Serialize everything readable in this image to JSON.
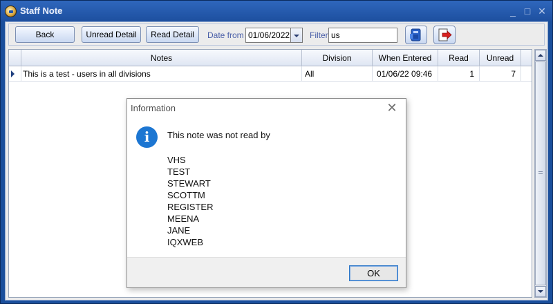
{
  "window": {
    "title": "Staff Note",
    "minimize_glyph": "_",
    "maximize_glyph": "□",
    "close_glyph": "✕"
  },
  "toolbar": {
    "back_label": "Back",
    "unread_detail_label": "Unread Detail",
    "read_detail_label": "Read Detail",
    "date_from_label": "Date from",
    "date_from_value": "01/06/2022",
    "filter_label": "Filter",
    "filter_value": "us",
    "icons": [
      "export-icon",
      "exit-icon"
    ]
  },
  "grid": {
    "columns": [
      "Notes",
      "Division",
      "When Entered",
      "Read",
      "Unread"
    ],
    "rows": [
      {
        "notes": "This is a test - users in all divisions",
        "division": "All",
        "when_entered": "01/06/22 09:46",
        "read": "1",
        "unread": "7"
      }
    ]
  },
  "dialog": {
    "title": "Information",
    "close_glyph": "✕",
    "icon": "info-icon",
    "icon_glyph": "i",
    "message": "This note was not read by",
    "names": [
      "VHS",
      "TEST",
      "STEWART",
      "SCOTTM",
      "REGISTER",
      "MEENA",
      "JANE",
      "IQXWEB"
    ],
    "ok_label": "OK"
  },
  "colors": {
    "window_frame": "#1a4f9c",
    "info_blue": "#1c76d2",
    "label_blue": "#4a5fa8"
  }
}
